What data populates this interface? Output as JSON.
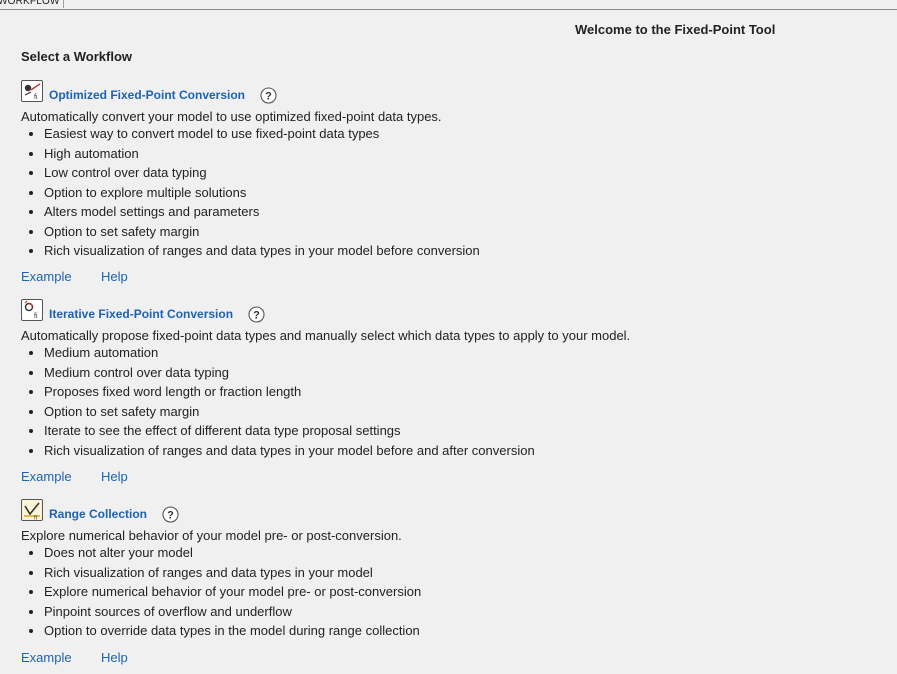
{
  "tab": {
    "label": "WORKFLOW"
  },
  "header": {
    "welcome": "Welcome to the Fixed-Point Tool",
    "select": "Select a Workflow"
  },
  "colors": {
    "link": "#1d62b6",
    "background": "#f0f0f0"
  },
  "sections": [
    {
      "title": "Optimized Fixed-Point Conversion",
      "icon": "optimized-conversion-icon",
      "description": "Automatically convert your model to use optimized fixed-point data types.",
      "bullets": [
        "Easiest way to convert model to use fixed-point data types",
        "High automation",
        "Low control over data typing",
        "Option to explore multiple solutions",
        "Alters model settings and parameters",
        "Option to set safety margin",
        "Rich visualization of ranges and data types in your model before conversion"
      ],
      "example_label": "Example",
      "help_label": "Help"
    },
    {
      "title": "Iterative Fixed-Point Conversion",
      "icon": "iterative-conversion-icon",
      "description": "Automatically propose fixed-point data types and manually select which data types to apply to your model.",
      "bullets": [
        "Medium automation",
        "Medium control over data typing",
        "Proposes fixed word length or fraction length",
        "Option to set safety margin",
        "Iterate to see the effect of different data type proposal settings",
        "Rich visualization of ranges and data types in your model before and after conversion"
      ],
      "example_label": "Example",
      "help_label": "Help"
    },
    {
      "title": "Range Collection",
      "icon": "range-collection-icon",
      "description": "Explore numerical behavior of your model pre- or post-conversion.",
      "bullets": [
        "Does not alter your model",
        "Rich visualization of ranges and data types in your model",
        "Explore numerical behavior of your model pre- or post-conversion",
        "Pinpoint sources of overflow and underflow",
        "Option to override data types in the model during range collection"
      ],
      "example_label": "Example",
      "help_label": "Help"
    }
  ]
}
